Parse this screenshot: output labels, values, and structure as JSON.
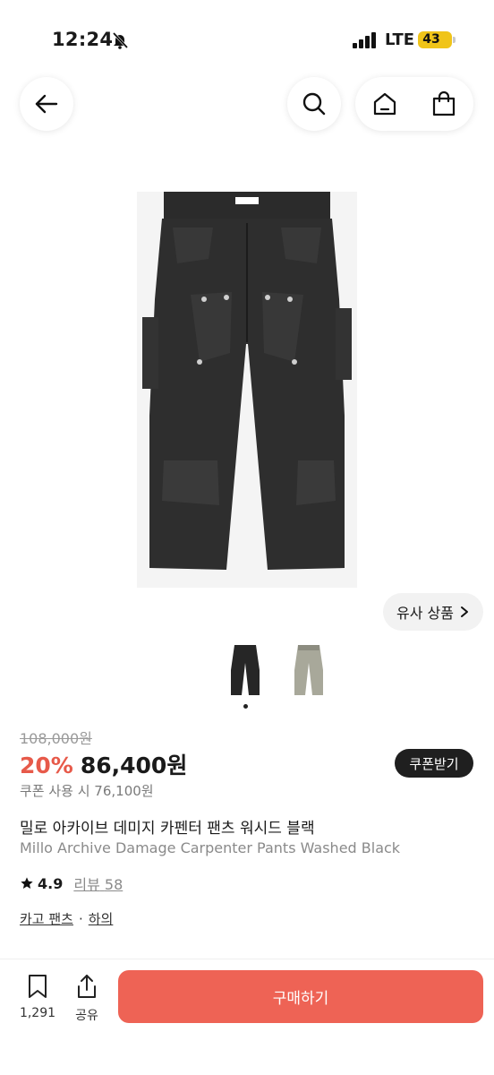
{
  "status": {
    "time": "12:24",
    "network": "LTE",
    "battery": "43"
  },
  "similar": {
    "label": "유사 상품"
  },
  "price": {
    "original": "108,000원",
    "discount": "20%",
    "sale": "86,400원",
    "coupon_price": "쿠폰 사용 시 76,100원",
    "coupon_button": "쿠폰받기"
  },
  "product": {
    "title_ko": "밀로 아카이브 데미지 카펜터 팬츠 워시드 블랙",
    "title_en": "Millo Archive Damage Carpenter Pants Washed Black",
    "rating": "4.9",
    "review_label": "리뷰",
    "review_count": "58",
    "categories": [
      "카고 팬츠",
      "하의"
    ],
    "category_separator": "·"
  },
  "bottom": {
    "bookmark_count": "1,291",
    "share_label": "공유",
    "buy_label": "구매하기"
  },
  "colors": {
    "accent": "#ee6355",
    "discount": "#e75a4a",
    "battery": "#f0c419"
  }
}
